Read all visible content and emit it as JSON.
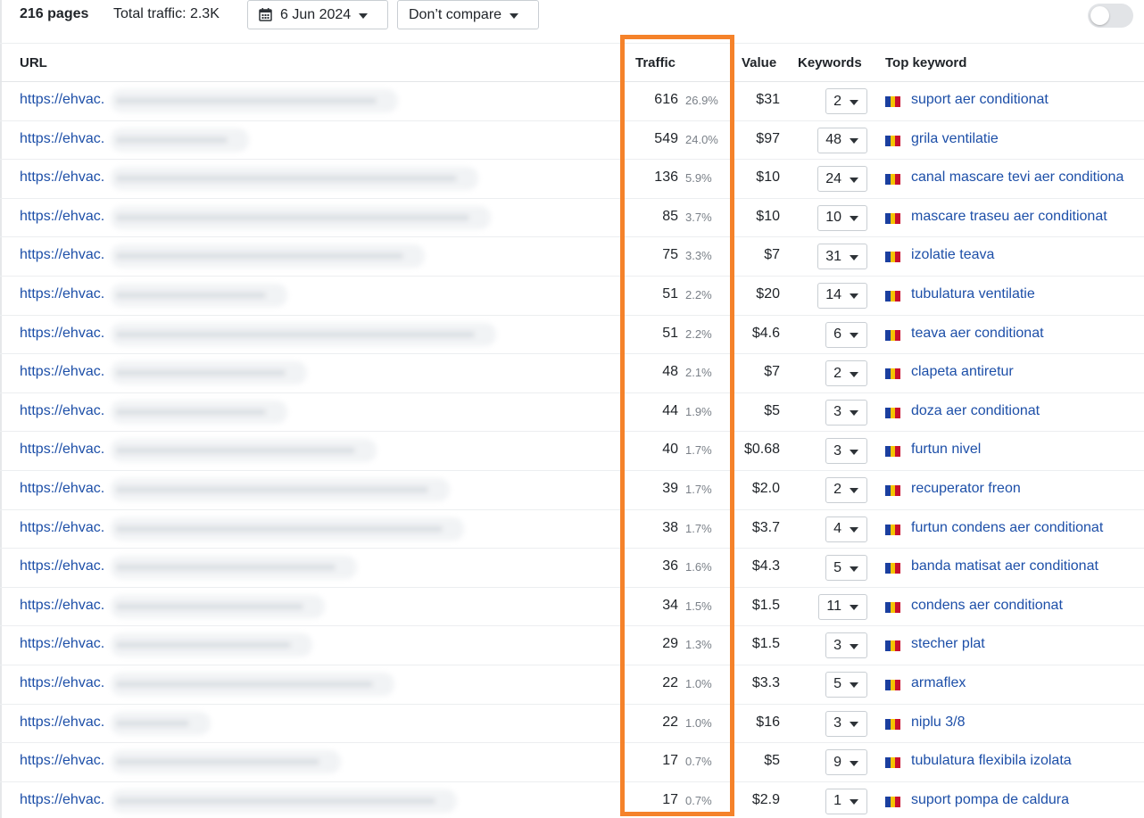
{
  "toolbar": {
    "pages_count": "216 pages",
    "total_traffic": "Total traffic: 2.3K",
    "date_label": "6 Jun 2024",
    "compare_label": "Don’t compare",
    "toggle_on": false
  },
  "table": {
    "columns": {
      "url": "URL",
      "traffic": "Traffic",
      "value": "Value",
      "keywords": "Keywords",
      "top_keyword": "Top keyword"
    },
    "rows": [
      {
        "url": "https://ehvac.",
        "traffic": "616",
        "pct": "26.9%",
        "value": "$31",
        "keywords": "2",
        "top_keyword": "suport aer conditionat"
      },
      {
        "url": "https://ehvac.",
        "traffic": "549",
        "pct": "24.0%",
        "value": "$97",
        "keywords": "48",
        "top_keyword": "grila ventilatie"
      },
      {
        "url": "https://ehvac.",
        "traffic": "136",
        "pct": "5.9%",
        "value": "$10",
        "keywords": "24",
        "top_keyword": "canal mascare tevi aer conditiona"
      },
      {
        "url": "https://ehvac.",
        "traffic": "85",
        "pct": "3.7%",
        "value": "$10",
        "keywords": "10",
        "top_keyword": "mascare traseu aer conditionat"
      },
      {
        "url": "https://ehvac.",
        "traffic": "75",
        "pct": "3.3%",
        "value": "$7",
        "keywords": "31",
        "top_keyword": "izolatie teava"
      },
      {
        "url": "https://ehvac.",
        "traffic": "51",
        "pct": "2.2%",
        "value": "$20",
        "keywords": "14",
        "top_keyword": "tubulatura ventilatie"
      },
      {
        "url": "https://ehvac.",
        "traffic": "51",
        "pct": "2.2%",
        "value": "$4.6",
        "keywords": "6",
        "top_keyword": "teava aer conditionat"
      },
      {
        "url": "https://ehvac.",
        "traffic": "48",
        "pct": "2.1%",
        "value": "$7",
        "keywords": "2",
        "top_keyword": "clapeta antiretur"
      },
      {
        "url": "https://ehvac.",
        "traffic": "44",
        "pct": "1.9%",
        "value": "$5",
        "keywords": "3",
        "top_keyword": "doza aer conditionat"
      },
      {
        "url": "https://ehvac.",
        "traffic": "40",
        "pct": "1.7%",
        "value": "$0.68",
        "keywords": "3",
        "top_keyword": "furtun nivel"
      },
      {
        "url": "https://ehvac.",
        "traffic": "39",
        "pct": "1.7%",
        "value": "$2.0",
        "keywords": "2",
        "top_keyword": "recuperator freon"
      },
      {
        "url": "https://ehvac.",
        "traffic": "38",
        "pct": "1.7%",
        "value": "$3.7",
        "keywords": "4",
        "top_keyword": "furtun condens aer conditionat"
      },
      {
        "url": "https://ehvac.",
        "traffic": "36",
        "pct": "1.6%",
        "value": "$4.3",
        "keywords": "5",
        "top_keyword": "banda matisat aer conditionat"
      },
      {
        "url": "https://ehvac.",
        "traffic": "34",
        "pct": "1.5%",
        "value": "$1.5",
        "keywords": "11",
        "top_keyword": "condens aer conditionat"
      },
      {
        "url": "https://ehvac.",
        "traffic": "29",
        "pct": "1.3%",
        "value": "$1.5",
        "keywords": "3",
        "top_keyword": "stecher plat"
      },
      {
        "url": "https://ehvac.",
        "traffic": "22",
        "pct": "1.0%",
        "value": "$3.3",
        "keywords": "5",
        "top_keyword": "armaflex"
      },
      {
        "url": "https://ehvac.",
        "traffic": "22",
        "pct": "1.0%",
        "value": "$16",
        "keywords": "3",
        "top_keyword": "niplu 3/8"
      },
      {
        "url": "https://ehvac.",
        "traffic": "17",
        "pct": "0.7%",
        "value": "$5",
        "keywords": "9",
        "top_keyword": "tubulatura flexibila izolata"
      },
      {
        "url": "https://ehvac.",
        "traffic": "17",
        "pct": "0.7%",
        "value": "$2.9",
        "keywords": "1",
        "top_keyword": "suport pompa de caldura"
      }
    ]
  },
  "icons": {
    "date": "calendar-icon",
    "dropdown": "chevron-down-icon",
    "country_flag": "romania-flag-icon"
  },
  "colors": {
    "link": "#1d4fa8",
    "highlight": "#f5822a",
    "flag_blue": "#1b3f9e",
    "flag_yellow": "#f5c400",
    "flag_red": "#c8102e"
  }
}
